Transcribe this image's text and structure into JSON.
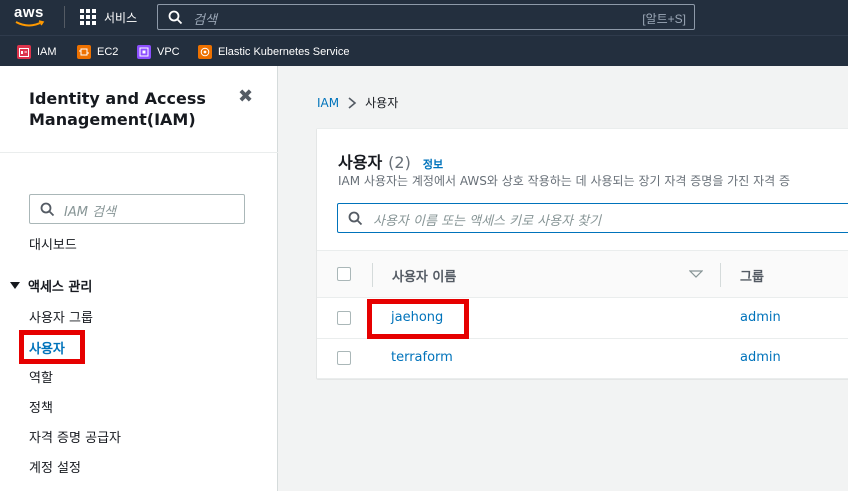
{
  "topbar": {
    "logo_text": "aws",
    "services_label": "서비스",
    "search_placeholder": "검색",
    "search_shortcut": "[알트+S]"
  },
  "favorites": [
    {
      "label": "IAM",
      "icon": "iam-icon",
      "color": "#dd344c"
    },
    {
      "label": "EC2",
      "icon": "ec2-icon",
      "color": "#ed7100"
    },
    {
      "label": "VPC",
      "icon": "vpc-icon",
      "color": "#8c4fff"
    },
    {
      "label": "Elastic Kubernetes Service",
      "icon": "eks-icon",
      "color": "#ed7100"
    }
  ],
  "sidebar": {
    "title": "Identity and Access Management(IAM)",
    "search_placeholder": "IAM 검색",
    "dashboard": "대시보드",
    "section": "액세스 관리",
    "items": [
      "사용자 그룹",
      "사용자",
      "역할",
      "정책",
      "자격 증명 공급자",
      "계정 설정"
    ],
    "active_index": 1
  },
  "breadcrumb": {
    "root": "IAM",
    "current": "사용자"
  },
  "panel": {
    "title": "사용자",
    "count": "(2)",
    "info": "정보",
    "description": "IAM 사용자는 계정에서 AWS와 상호 작용하는 데 사용되는 장기 자격 증명을 가진 자격 증",
    "search_placeholder": "사용자 이름 또는 액세스 키로 사용자 찾기",
    "columns": [
      "사용자 이름",
      "그룹"
    ],
    "rows": [
      {
        "name": "jaehong",
        "group": "admin",
        "highlighted": true
      },
      {
        "name": "terraform",
        "group": "admin",
        "highlighted": false
      }
    ]
  },
  "colors": {
    "link": "#0073bb",
    "topbar": "#232f3e",
    "highlight": "#e60000"
  }
}
